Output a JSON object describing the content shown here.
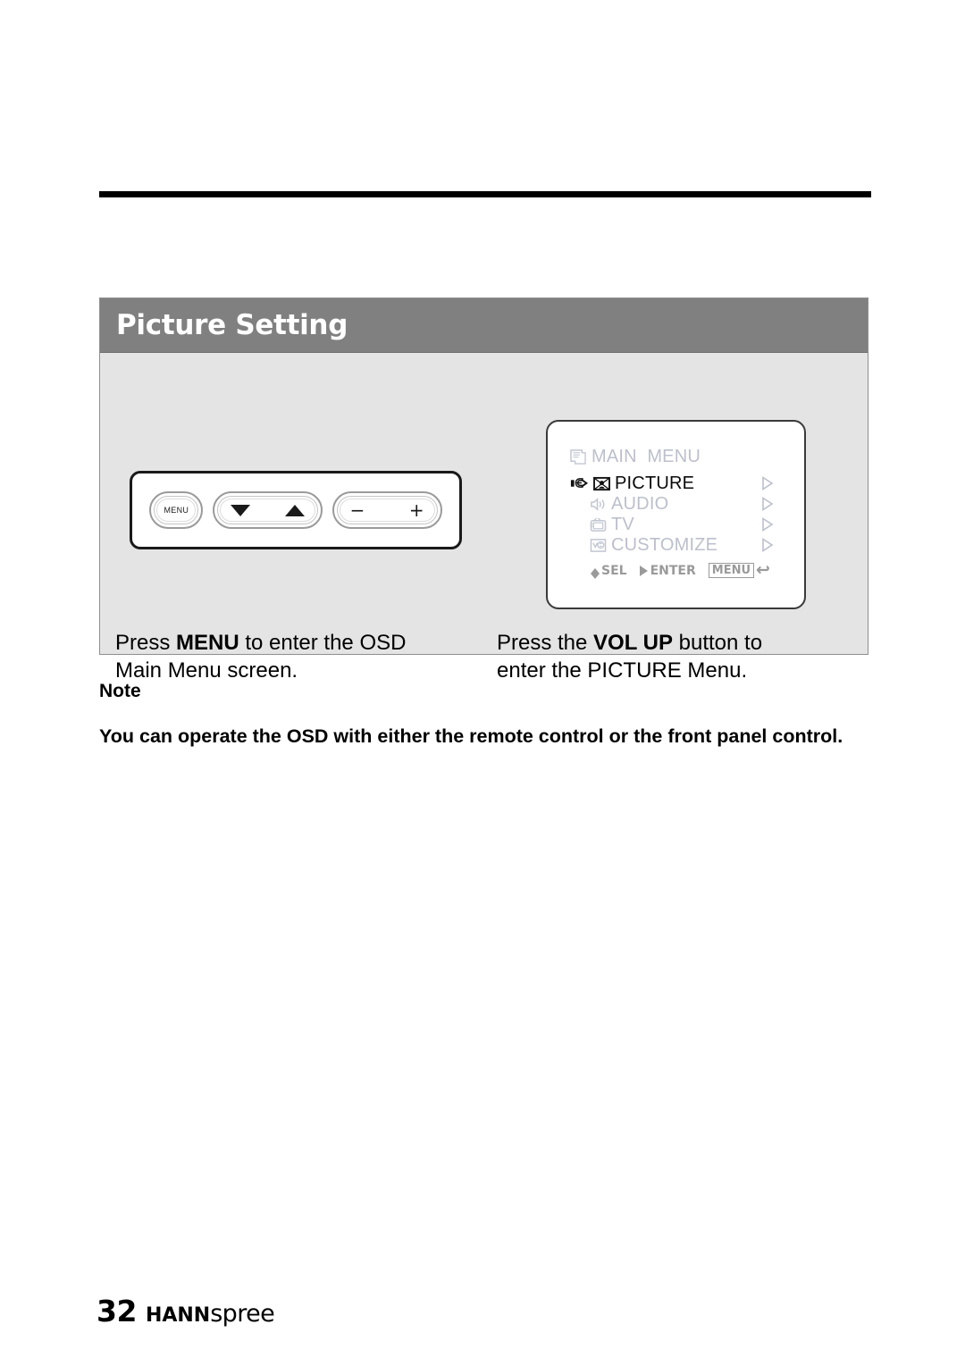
{
  "page": {
    "number": "32",
    "brand_bold": "HANN",
    "brand_light": "spree"
  },
  "panel": {
    "title": "Picture Setting"
  },
  "front_panel_control": {
    "menu_button_label": "MENU",
    "down_icon": "triangle-down-icon",
    "up_icon": "triangle-up-icon",
    "minus_label": "−",
    "plus_label": "+"
  },
  "osd": {
    "title": "MAIN  MENU",
    "title_icon": "main-menu-document-icon",
    "cursor_icon": "pointing-hand-icon",
    "items": [
      {
        "label": "PICTURE",
        "icon": "picture-icon",
        "selected": true,
        "arrow": "▷"
      },
      {
        "label": "AUDIO",
        "icon": "speaker-icon",
        "selected": false,
        "arrow": "▷"
      },
      {
        "label": "TV",
        "icon": "tv-icon",
        "selected": false,
        "arrow": "▷"
      },
      {
        "label": "CUSTOMIZE",
        "icon": "customize-icon",
        "selected": false,
        "arrow": "▷"
      }
    ],
    "footer": {
      "sel_label": "SEL",
      "enter_label": "ENTER",
      "menu_key_label": "MENU",
      "back_glyph": "↩"
    }
  },
  "captions": {
    "left": {
      "before": "Press ",
      "strong": "MENU",
      "after": " to enter the OSD\nMain Menu screen."
    },
    "right": {
      "before": "Press the ",
      "strong": "VOL UP",
      "after": " button to\nenter the PICTURE Menu."
    }
  },
  "note": {
    "heading": "Note",
    "body": "You can operate the OSD with either the remote control or the front panel control."
  },
  "colors": {
    "header_bar": "#808080",
    "panel_body": "#e4e4e4",
    "osd_dim_text": "#bcc0cc",
    "osd_active_text": "#0a0a0a",
    "rule": "#000000"
  }
}
